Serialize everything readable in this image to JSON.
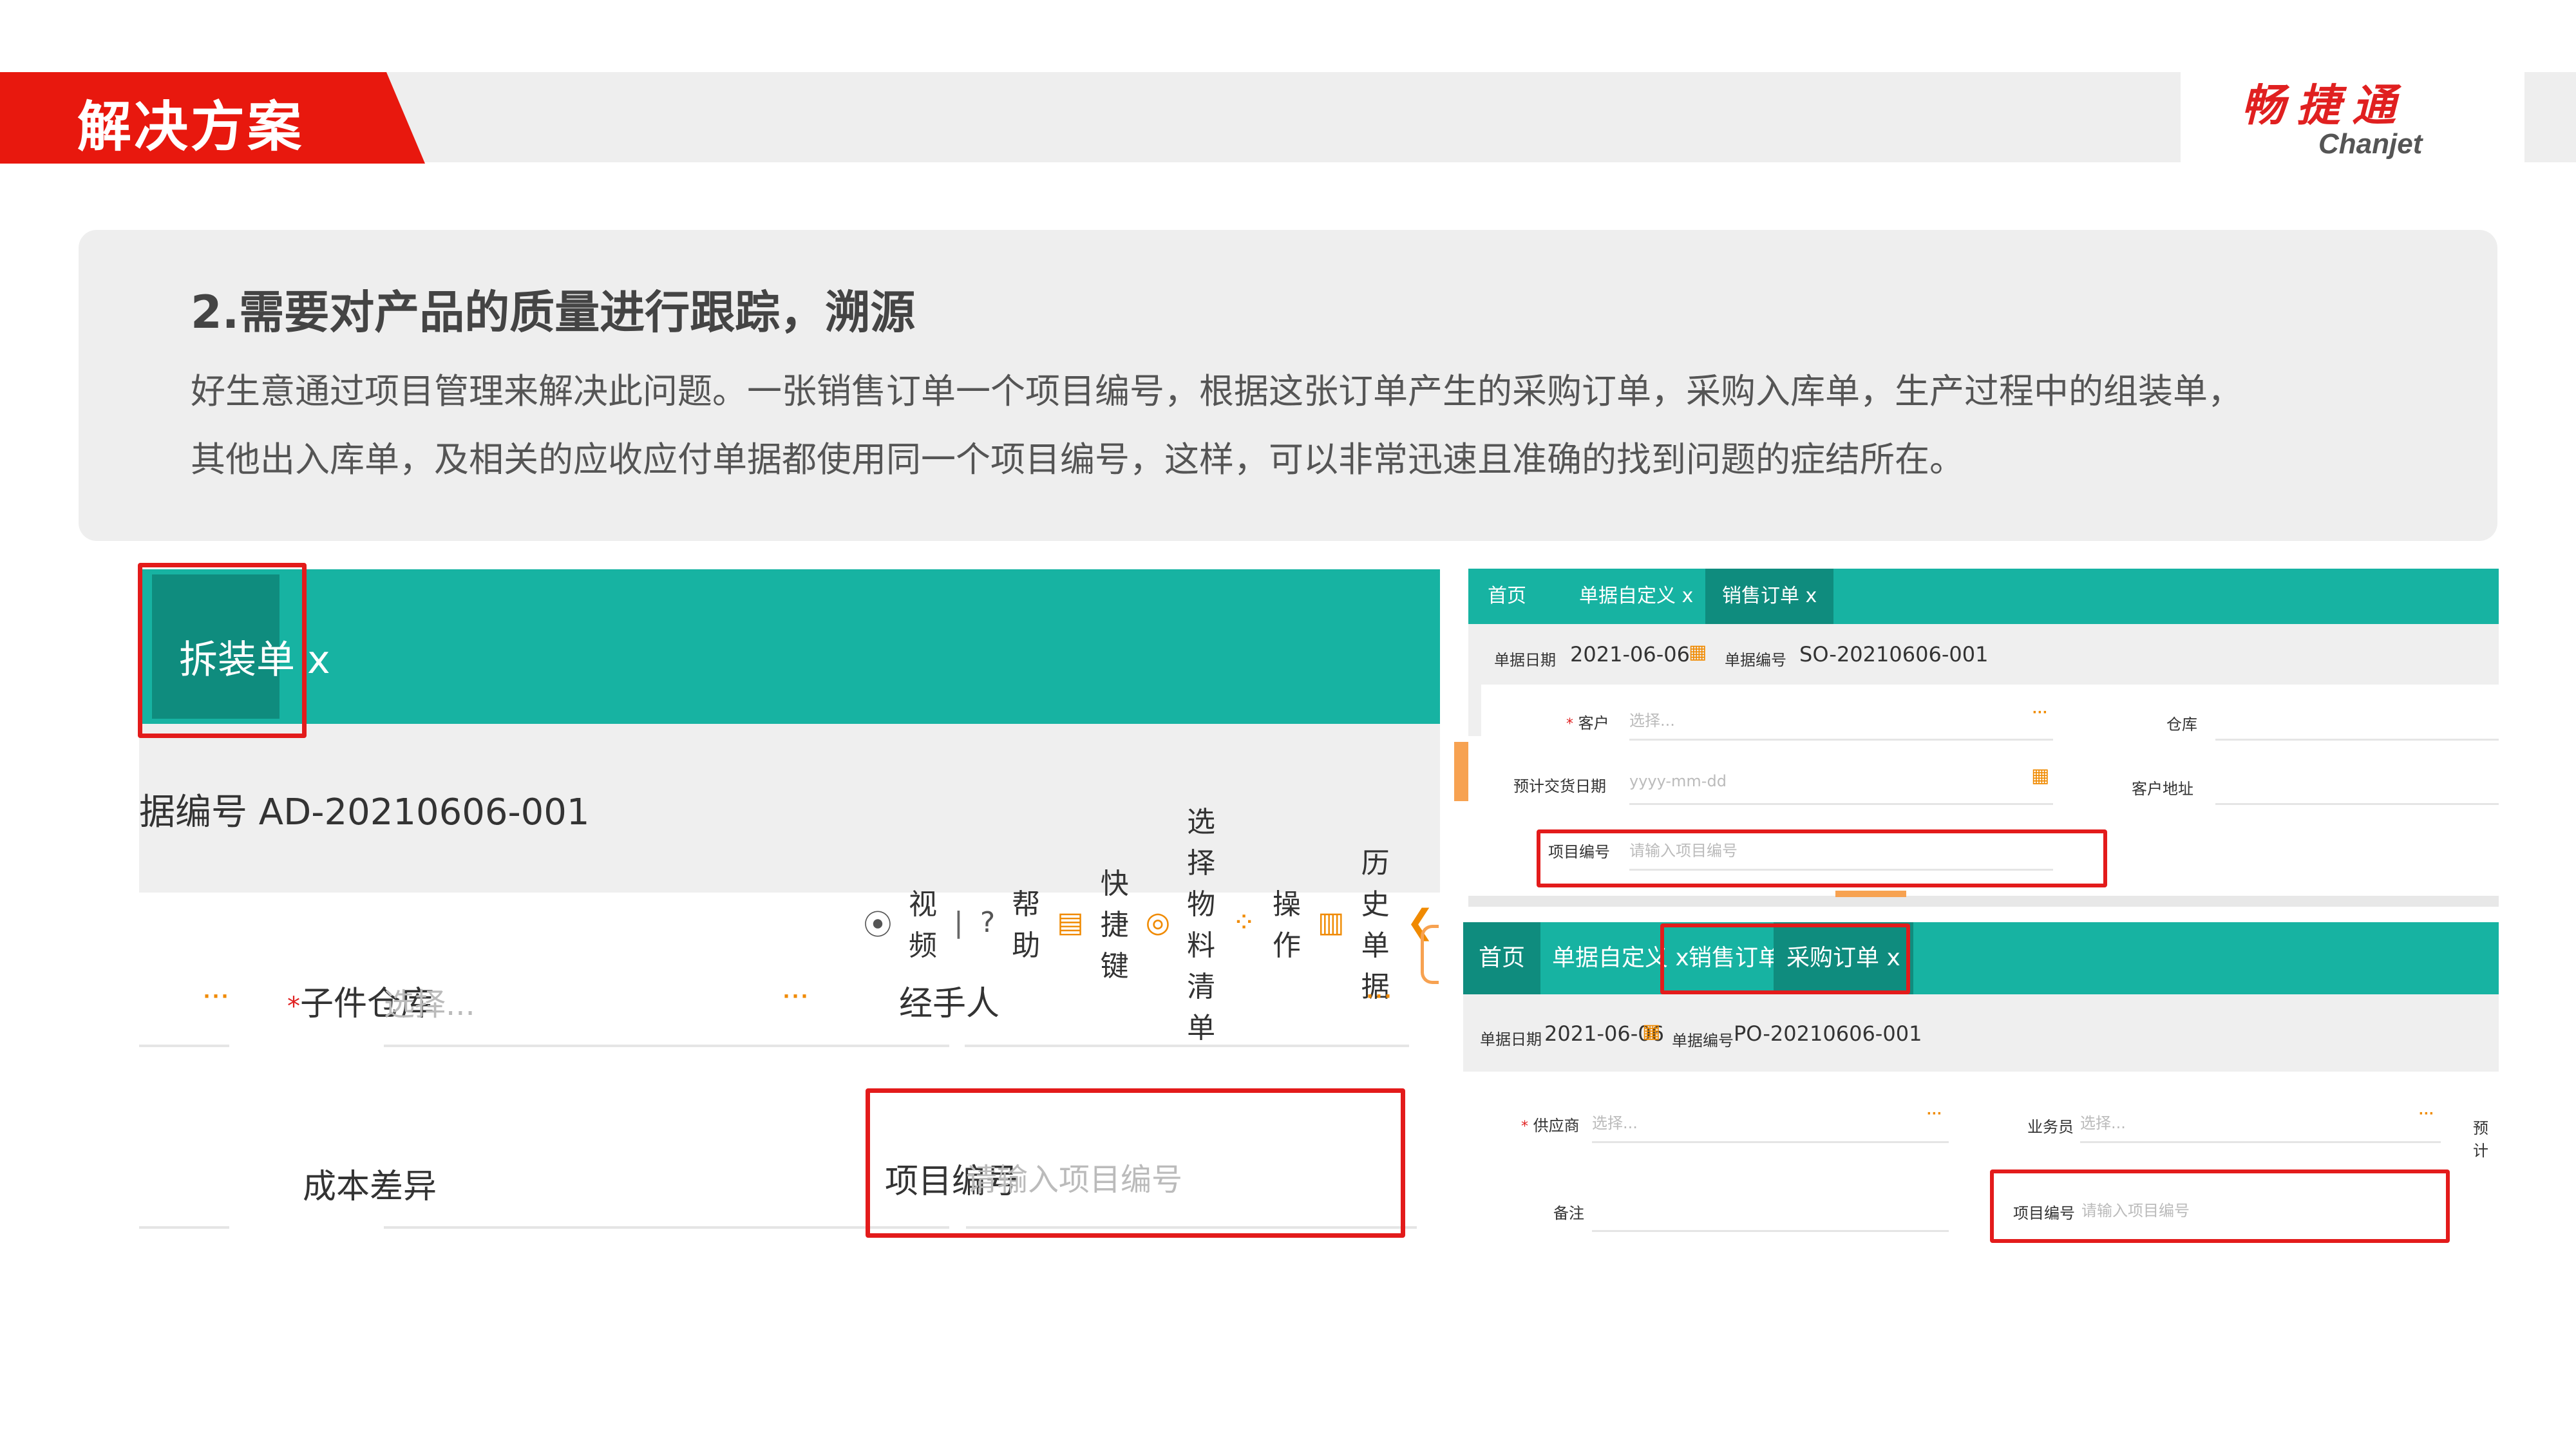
{
  "header": {
    "title": "解决方案",
    "logo_cn": "畅捷通",
    "logo_en": "Chanjet"
  },
  "intro": {
    "heading": "2.需要对产品的质量进行跟踪，溯源",
    "body_line1": "好生意通过项目管理来解决此问题。一张销售订单一个项目编号，根据这张订单产生的采购订单，采购入库单，生产过程中的组装单，",
    "body_line2": "其他出入库单，及相关的应收应付单据都使用同一个项目编号，这样，可以非常迅速且准确的找到问题的症结所在。"
  },
  "left_shot": {
    "tab_label": "拆装单 x",
    "doc_no": "据编号  AD-20210606-001",
    "toolbar": {
      "video": "视频",
      "help": "帮助",
      "shortcut": "快捷键",
      "select_bom": "选择物料清单",
      "operate": "操作",
      "history": "历史单据"
    },
    "fields": {
      "sub_warehouse_label": "子件仓库",
      "sub_warehouse_placeholder": "选择...",
      "handler_label": "经手人",
      "cost_diff_label": "成本差异",
      "project_no_label": "项目编号",
      "project_no_placeholder": "请输入项目编号"
    }
  },
  "sales_order": {
    "tabs": [
      "首页",
      "单据自定义 x",
      "销售订单 x"
    ],
    "date_label": "单据日期",
    "date_value": "2021-06-06",
    "no_label": "单据编号",
    "no_value": "SO-20210606-001",
    "customer_label": "客户",
    "customer_placeholder": "选择...",
    "warehouse_label": "仓库",
    "delivery_label": "预计交货日期",
    "delivery_placeholder": "yyyy-mm-dd",
    "address_label": "客户地址",
    "project_label": "项目编号",
    "project_placeholder": "请输入项目编号"
  },
  "purchase_order": {
    "tabs": [
      "首页",
      "单据自定义 x",
      "销售订单 x",
      "采购订单 x"
    ],
    "date_label": "单据日期",
    "date_value": "2021-06-06",
    "no_label": "单据编号",
    "no_value": "PO-20210606-001",
    "supplier_label": "供应商",
    "supplier_placeholder": "选择...",
    "salesman_label": "业务员",
    "salesman_placeholder": "选择...",
    "cutoff_label": "预计",
    "remark_label": "备注",
    "project_label": "项目编号",
    "project_placeholder": "请输入项目编号"
  },
  "colors": {
    "accent_red": "#e8180e",
    "teal": "#17b3a2",
    "teal_dark": "#0f8c7e",
    "highlight_red": "#e31b1b",
    "orange": "#f08a00"
  }
}
